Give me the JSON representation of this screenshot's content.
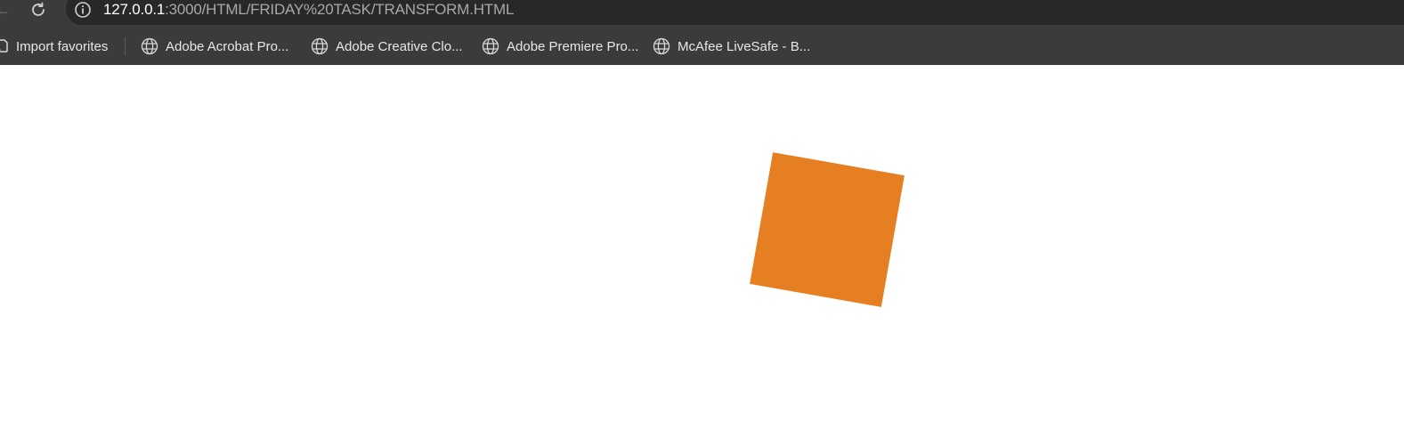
{
  "browser": {
    "url_host": "127.0.0.1",
    "url_path": ":3000/HTML/FRIDAY%20TASK/TRANSFORM.HTML"
  },
  "bookmarks": {
    "import_favorites": "Import favorites",
    "items": [
      "Adobe Acrobat Pro...",
      "Adobe Creative Clo...",
      "Adobe Premiere Pro...",
      "McAfee LiveSafe - B..."
    ]
  },
  "page": {
    "box_color": "#e67e22",
    "box_rotation_deg": 10
  }
}
